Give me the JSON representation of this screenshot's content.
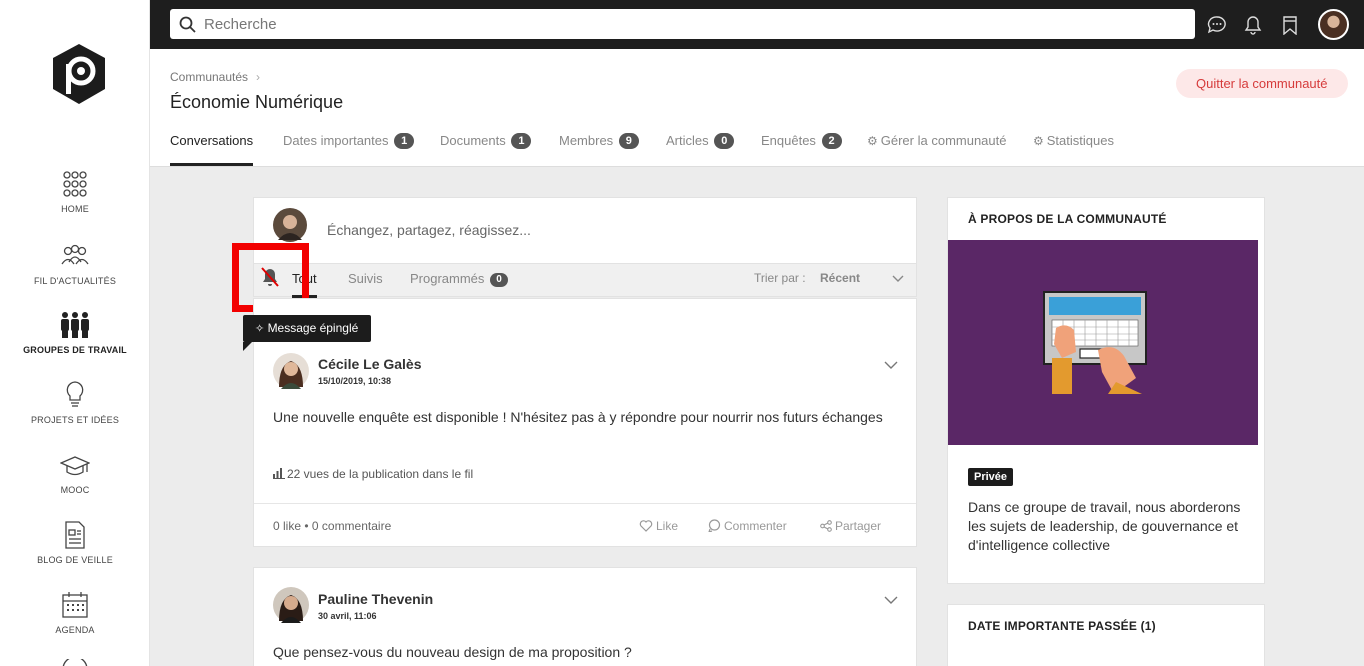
{
  "sidebar": {
    "items": [
      {
        "label": "HOME",
        "icon": "grid-icon"
      },
      {
        "label": "FIL D'ACTUALITÉS",
        "icon": "people-feed-icon"
      },
      {
        "label": "GROUPES DE TRAVAIL",
        "icon": "group-icon",
        "active": true
      },
      {
        "label": "PROJETS ET IDÉES",
        "icon": "lightbulb-icon"
      },
      {
        "label": "MOOC",
        "icon": "graduation-cap-icon"
      },
      {
        "label": "BLOG DE VEILLE",
        "icon": "document-icon"
      },
      {
        "label": "AGENDA",
        "icon": "calendar-icon"
      }
    ]
  },
  "topbar": {
    "search_placeholder": "Recherche",
    "icons": [
      "chat-icon",
      "bell-icon",
      "bookmark-icon",
      "user-avatar"
    ]
  },
  "header": {
    "breadcrumb": "Communautés",
    "title": "Économie Numérique",
    "quit_label": "Quitter la communauté",
    "tabs": [
      {
        "label": "Conversations",
        "active": true
      },
      {
        "label": "Dates importantes",
        "count": "1"
      },
      {
        "label": "Documents",
        "count": "1"
      },
      {
        "label": "Membres",
        "count": "9"
      },
      {
        "label": "Articles",
        "count": "0"
      },
      {
        "label": "Enquêtes",
        "count": "2"
      },
      {
        "label": "Gérer la communauté",
        "icon": "gear-icon"
      },
      {
        "label": "Statistiques",
        "icon": "gear-icon"
      }
    ]
  },
  "composer": {
    "placeholder": "Échangez, partagez, réagissez..."
  },
  "filters": {
    "tabs": [
      {
        "label": "Tout",
        "active": true
      },
      {
        "label": "Suivis"
      },
      {
        "label": "Programmés",
        "count": "0"
      }
    ],
    "sort_label": "Trier par :",
    "sort_value": "Récent"
  },
  "tooltip": {
    "label": "Message épinglé",
    "icon": "pin-icon"
  },
  "posts": [
    {
      "author": "Cécile Le Galès",
      "date": "15/10/2019, 10:38",
      "body": "Une nouvelle enquête est disponible ! N'hésitez pas à y répondre pour nourrir nos futurs échanges",
      "views": "22 vues de la publication dans le fil",
      "stats": "0 like • 0 commentaire",
      "actions": {
        "like": "Like",
        "comment": "Commenter",
        "share": "Partager"
      }
    },
    {
      "author": "Pauline Thevenin",
      "date": "30 avril, 11:06",
      "body": "Que pensez-vous du nouveau design de ma proposition ?"
    }
  ],
  "about": {
    "title": "À PROPOS DE LA COMMUNAUTÉ",
    "privacy": "Privée",
    "description": "Dans ce groupe de travail, nous aborderons les sujets de leadership, de gouvernance et d'intelligence collective"
  },
  "dates_card": {
    "title": "DATE IMPORTANTE PASSÉE (1)"
  },
  "colors": {
    "topbar": "#1e1e1e",
    "quit_bg": "#fde8e8",
    "quit_text": "#d63b3b",
    "illustration_bg": "#5a2766",
    "highlight": "#f20000"
  }
}
